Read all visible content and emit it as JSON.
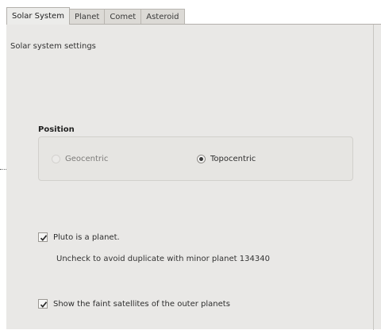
{
  "tabs": [
    {
      "label": "Solar System",
      "active": true
    },
    {
      "label": "Planet",
      "active": false
    },
    {
      "label": "Comet",
      "active": false
    },
    {
      "label": "Asteroid",
      "active": false
    }
  ],
  "panel": {
    "heading": "Solar system settings",
    "position_group": {
      "title": "Position",
      "options": [
        {
          "label": "Geocentric",
          "selected": false,
          "enabled": false
        },
        {
          "label": "Topocentric",
          "selected": true,
          "enabled": true
        }
      ]
    },
    "pluto": {
      "label": "Pluto is a planet.",
      "checked": true,
      "hint": "Uncheck to avoid duplicate with minor planet 134340"
    },
    "satellites": {
      "label": "Show the faint satellites of the outer planets",
      "checked": true
    }
  },
  "icons": {
    "checkmark": "check-icon"
  }
}
